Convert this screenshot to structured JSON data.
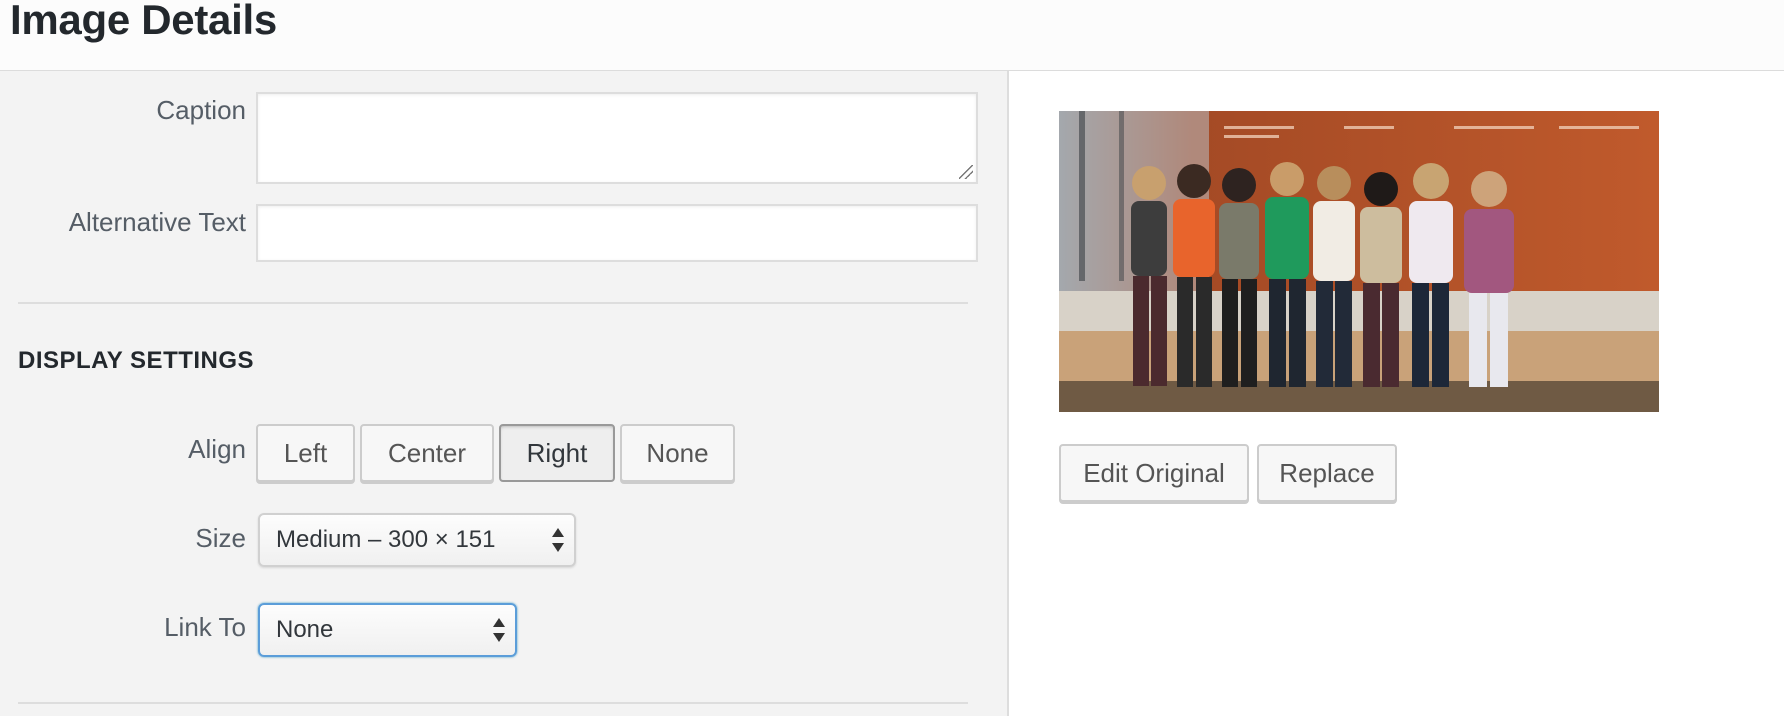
{
  "header": {
    "title": "Image Details"
  },
  "form": {
    "caption": {
      "label": "Caption",
      "value": ""
    },
    "alt_text": {
      "label": "Alternative Text",
      "value": ""
    }
  },
  "display_settings": {
    "title": "DISPLAY SETTINGS",
    "align": {
      "label": "Align",
      "options": [
        "Left",
        "Center",
        "Right",
        "None"
      ],
      "selected": "Right"
    },
    "size": {
      "label": "Size",
      "selected": "Medium – 300 × 151"
    },
    "link_to": {
      "label": "Link To",
      "selected": "None"
    }
  },
  "preview": {
    "image_icon": "photo-icon",
    "buttons": {
      "edit_original": "Edit Original",
      "replace": "Replace"
    }
  },
  "colors": {
    "accent_focus": "#5b9dd9",
    "panel_bg": "#f3f3f3",
    "photo_backdrop": "#c05a2c"
  }
}
